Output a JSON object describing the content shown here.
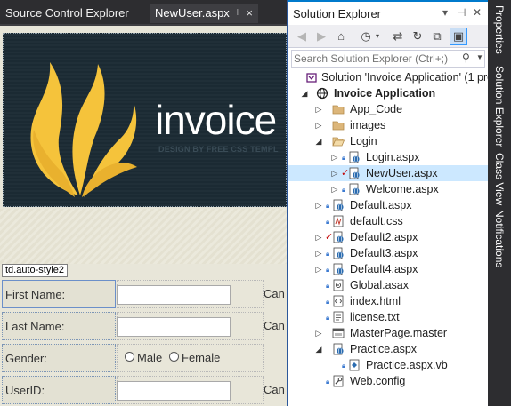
{
  "document_tabs": {
    "inactive_label": "Source Control Explorer",
    "active_label": "NewUser.aspx",
    "pin_glyph": "⊣",
    "close_glyph": "×"
  },
  "design_view": {
    "banner_title": "invoice",
    "banner_subtitle": "DESIGN BY FREE CSS TEMPL",
    "selected_tag": "td.auto-style2",
    "rows": [
      {
        "label": "First Name:",
        "side_text": "Can"
      },
      {
        "label": "Last Name:",
        "side_text": "Can"
      },
      {
        "label": "Gender:",
        "radio_male": "Male",
        "radio_female": "Female"
      },
      {
        "label": "UserID:",
        "side_text": "Can"
      }
    ]
  },
  "solution_explorer": {
    "title": "Solution Explorer",
    "search_placeholder": "Search Solution Explorer (Ctrl+;)",
    "tree": [
      {
        "label": "Solution 'Invoice Application' (1 pro",
        "icon": "solution-icon"
      },
      {
        "label": "Invoice Application",
        "icon": "web-project-icon"
      },
      {
        "label": "App_Code",
        "icon": "folder-icon"
      },
      {
        "label": "images",
        "icon": "folder-icon"
      },
      {
        "label": "Login",
        "icon": "folder-open-icon"
      },
      {
        "label": "Login.aspx",
        "icon": "aspx-page-icon"
      },
      {
        "label": "NewUser.aspx",
        "icon": "aspx-page-icon"
      },
      {
        "label": "Welcome.aspx",
        "icon": "aspx-page-icon"
      },
      {
        "label": "Default.aspx",
        "icon": "aspx-page-icon"
      },
      {
        "label": "default.css",
        "icon": "css-file-icon"
      },
      {
        "label": "Default2.aspx",
        "icon": "aspx-page-icon"
      },
      {
        "label": "Default3.aspx",
        "icon": "aspx-page-icon"
      },
      {
        "label": "Default4.aspx",
        "icon": "aspx-page-icon"
      },
      {
        "label": "Global.asax",
        "icon": "asax-file-icon"
      },
      {
        "label": "index.html",
        "icon": "html-file-icon"
      },
      {
        "label": "license.txt",
        "icon": "text-file-icon"
      },
      {
        "label": "MasterPage.master",
        "icon": "master-page-icon"
      },
      {
        "label": "Practice.aspx",
        "icon": "aspx-page-icon"
      },
      {
        "label": "Practice.aspx.vb",
        "icon": "vb-file-icon"
      },
      {
        "label": "Web.config",
        "icon": "config-file-icon"
      }
    ]
  },
  "side_rail": {
    "tabs": [
      "Properties",
      "Solution Explorer",
      "Class View",
      "Notifications"
    ]
  },
  "colors": {
    "accent": "#007acc",
    "selection": "#cce8ff",
    "banner_background": "#1b2a33",
    "flame": "#f5c33b"
  }
}
